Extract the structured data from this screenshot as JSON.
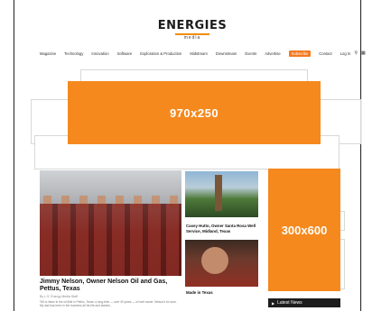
{
  "logo": {
    "word": "ENERGIES",
    "sub": "media"
  },
  "nav": {
    "items": [
      "Magazine",
      "Technology",
      "Innovation",
      "Software",
      "Exploration & Production",
      "Midstream",
      "Downstream",
      "Events",
      "Advertise"
    ],
    "subscribe": "Subscribe",
    "contact": "Contact",
    "login": "Log In"
  },
  "ads": {
    "leaderboard": "970x250",
    "skyscraper": "300x600"
  },
  "feature": {
    "title": "Jimmy Nelson, Owner Nelson Oil and Gas, Pettus, Texas",
    "byline": "By L.S. Energy Media Staff",
    "excerpt": "Tell or listen in the oil field in Pettus, Texas, a long-time — over 40 years — oil well owner. Nelson's for sure. My dad has been in the business all his life and started..."
  },
  "stories": [
    {
      "title": "Casey Hutto, Owner Santa Rosa Well Service, Midland, Texas"
    },
    {
      "title": "Made in Texas"
    }
  ],
  "sidebar": {
    "latest": "Latest News"
  }
}
